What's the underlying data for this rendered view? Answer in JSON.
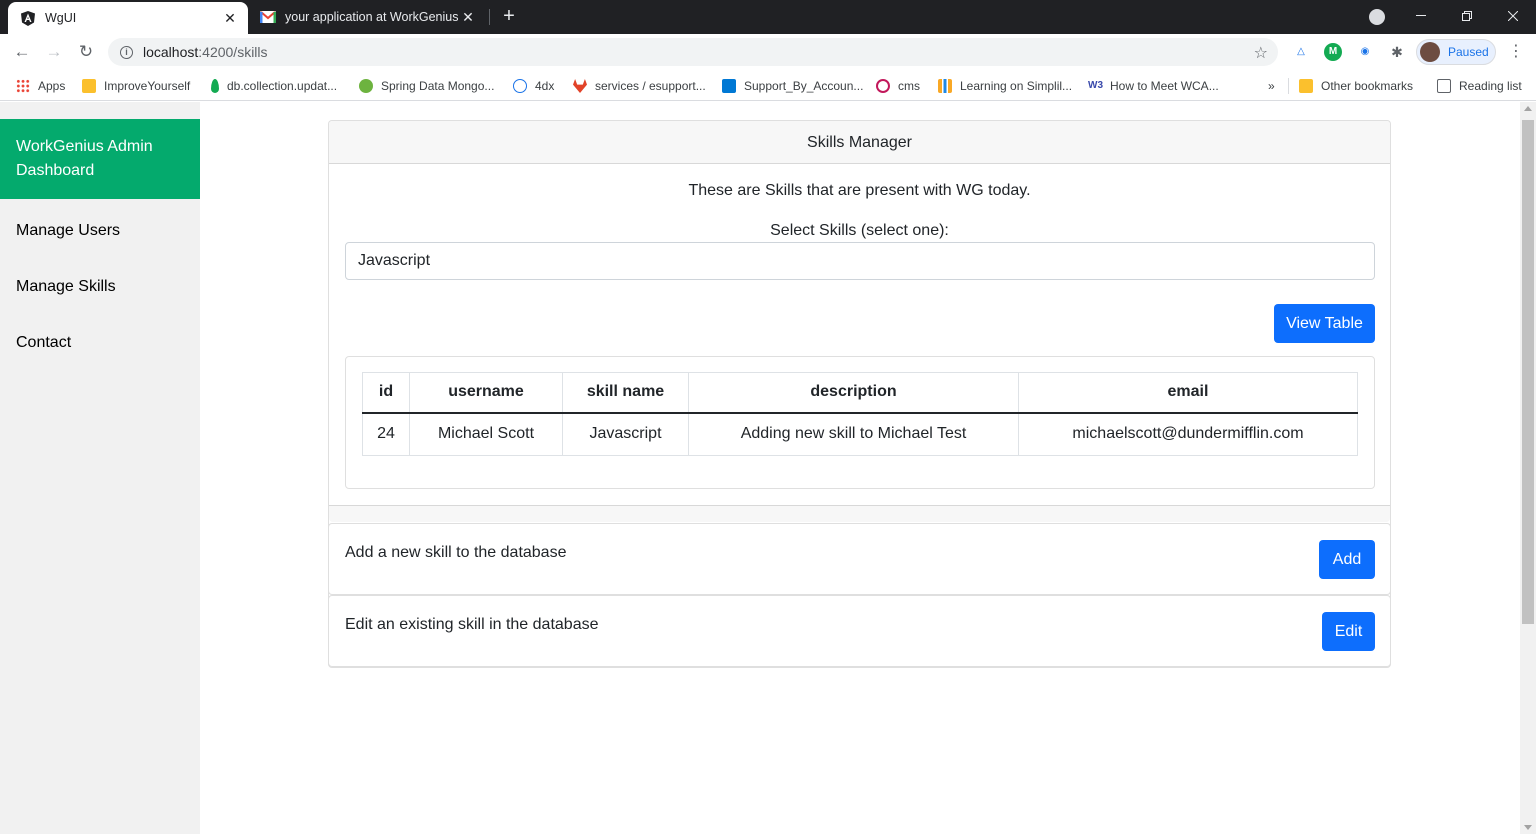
{
  "browser": {
    "active_tab_title": "WgUI",
    "inactive_tab_title": "your application at WorkGenius",
    "url_host": "localhost",
    "url_path": ":4200/skills",
    "profile_status": "Paused",
    "bookmarks": [
      {
        "label": "Apps",
        "color": "#ea4335"
      },
      {
        "label": "ImproveYourself",
        "color": "#fbc02d"
      },
      {
        "label": "db.collection.updat...",
        "color": "#13aa52"
      },
      {
        "label": "Spring Data Mongo...",
        "color": "#6db33f"
      },
      {
        "label": "4dx",
        "color": "#1a73e8"
      },
      {
        "label": "services / esupport...",
        "color": "#e24329"
      },
      {
        "label": "Support_By_Accoun...",
        "color": "#0078d4"
      },
      {
        "label": "cms",
        "color": "#c2185b"
      },
      {
        "label": "Learning on Simplil...",
        "color": "#f9a825"
      },
      {
        "label": "How to Meet WCA...",
        "color": "#3949ab"
      }
    ],
    "overflow_label": "»",
    "other_bookmarks": "Other bookmarks",
    "reading_list": "Reading list"
  },
  "sidebar": {
    "brand": "WorkGenius Admin Dashboard",
    "items": [
      "Manage Users",
      "Manage Skills",
      "Contact"
    ]
  },
  "skills_panel": {
    "header": "Skills Manager",
    "intro": "These are Skills that are present with WG today.",
    "select_label": "Select Skills (select one):",
    "selected_skill": "Javascript",
    "view_table_label": "View Table"
  },
  "table": {
    "columns": [
      "id",
      "username",
      "skill name",
      "description",
      "email"
    ],
    "rows": [
      [
        "24",
        "Michael Scott",
        "Javascript",
        "Adding new skill to Michael Test",
        "michaelscott@dundermifflin.com"
      ]
    ]
  },
  "add_card": {
    "text": "Add a new skill to the database",
    "button": "Add"
  },
  "edit_card": {
    "text": "Edit an existing skill in the database",
    "button": "Edit"
  },
  "colors": {
    "brand_green": "#04aa6d",
    "primary_blue": "#0d6efd"
  }
}
